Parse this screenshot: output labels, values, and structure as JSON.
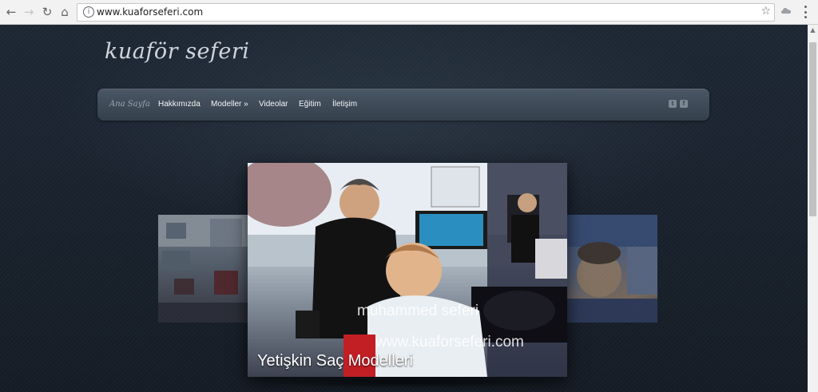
{
  "browser": {
    "url": "www.kuaforseferi.com",
    "icons": {
      "back": "back-arrow-icon",
      "forward": "forward-arrow-icon",
      "reload": "reload-icon",
      "home": "home-icon",
      "info": "info-icon",
      "bookmark": "star-icon",
      "extension": "extension-icon",
      "menu": "kebab-menu-icon"
    }
  },
  "site": {
    "logo": "kuaför seferi",
    "nav": [
      {
        "label": "Ana Sayfa"
      },
      {
        "label": "Hakkımızda"
      },
      {
        "label": "Modeller »"
      },
      {
        "label": "Videolar"
      },
      {
        "label": "Eğitim"
      },
      {
        "label": "İletişim"
      }
    ],
    "social": {
      "twitter": {
        "icon": "twitter-icon",
        "glyph": "t"
      },
      "facebook": {
        "icon": "facebook-icon",
        "glyph": "f"
      }
    }
  },
  "slider": {
    "main": {
      "watermark_name": "muhammed seferi",
      "watermark_url": "www.kuaforseferi.com",
      "caption": "Yetişkin Saç Modelleri"
    }
  },
  "colors": {
    "page_bg": "#1b2430",
    "navbar_bg": "#3e4a57",
    "nav_text": "#f3f5f7",
    "logo_text": "#cfd6dc"
  }
}
